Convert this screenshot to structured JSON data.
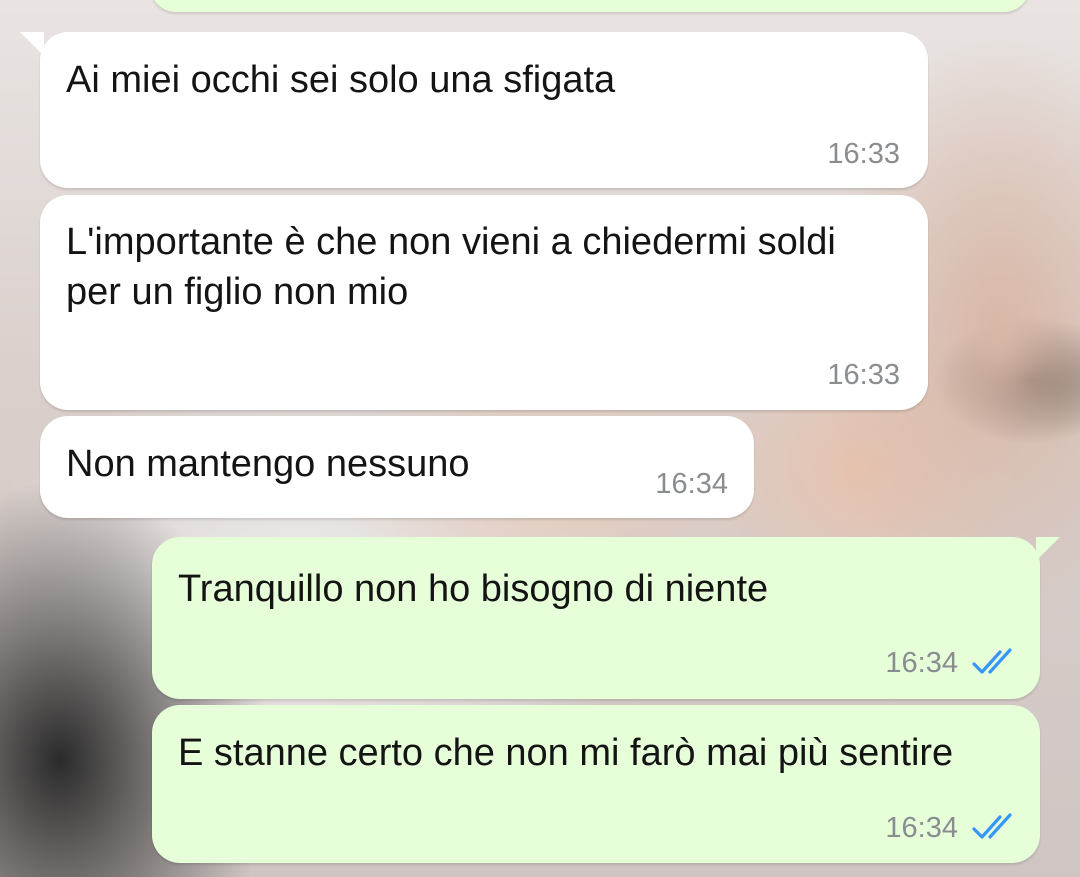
{
  "chat": {
    "messages": [
      {
        "direction": "incoming",
        "text": "Ai miei occhi sei solo una sfigata",
        "time": "16:33"
      },
      {
        "direction": "incoming",
        "text": "L'importante è che non vieni a chiedermi soldi per un figlio non mio",
        "time": "16:33"
      },
      {
        "direction": "incoming",
        "text": "Non mantengo nessuno",
        "time": "16:34"
      },
      {
        "direction": "outgoing",
        "text": "Tranquillo non ho bisogno di niente",
        "time": "16:34",
        "status": "read"
      },
      {
        "direction": "outgoing",
        "text": "E stanne certo che non mi farò mai più sentire",
        "time": "16:34",
        "status": "read"
      }
    ]
  },
  "colors": {
    "incoming_bubble": "#ffffff",
    "outgoing_bubble": "#e6ffd9",
    "read_ticks": "#3497f9",
    "time_text": "#8a8d8f"
  },
  "icons": {
    "status": "double-check-icon"
  }
}
